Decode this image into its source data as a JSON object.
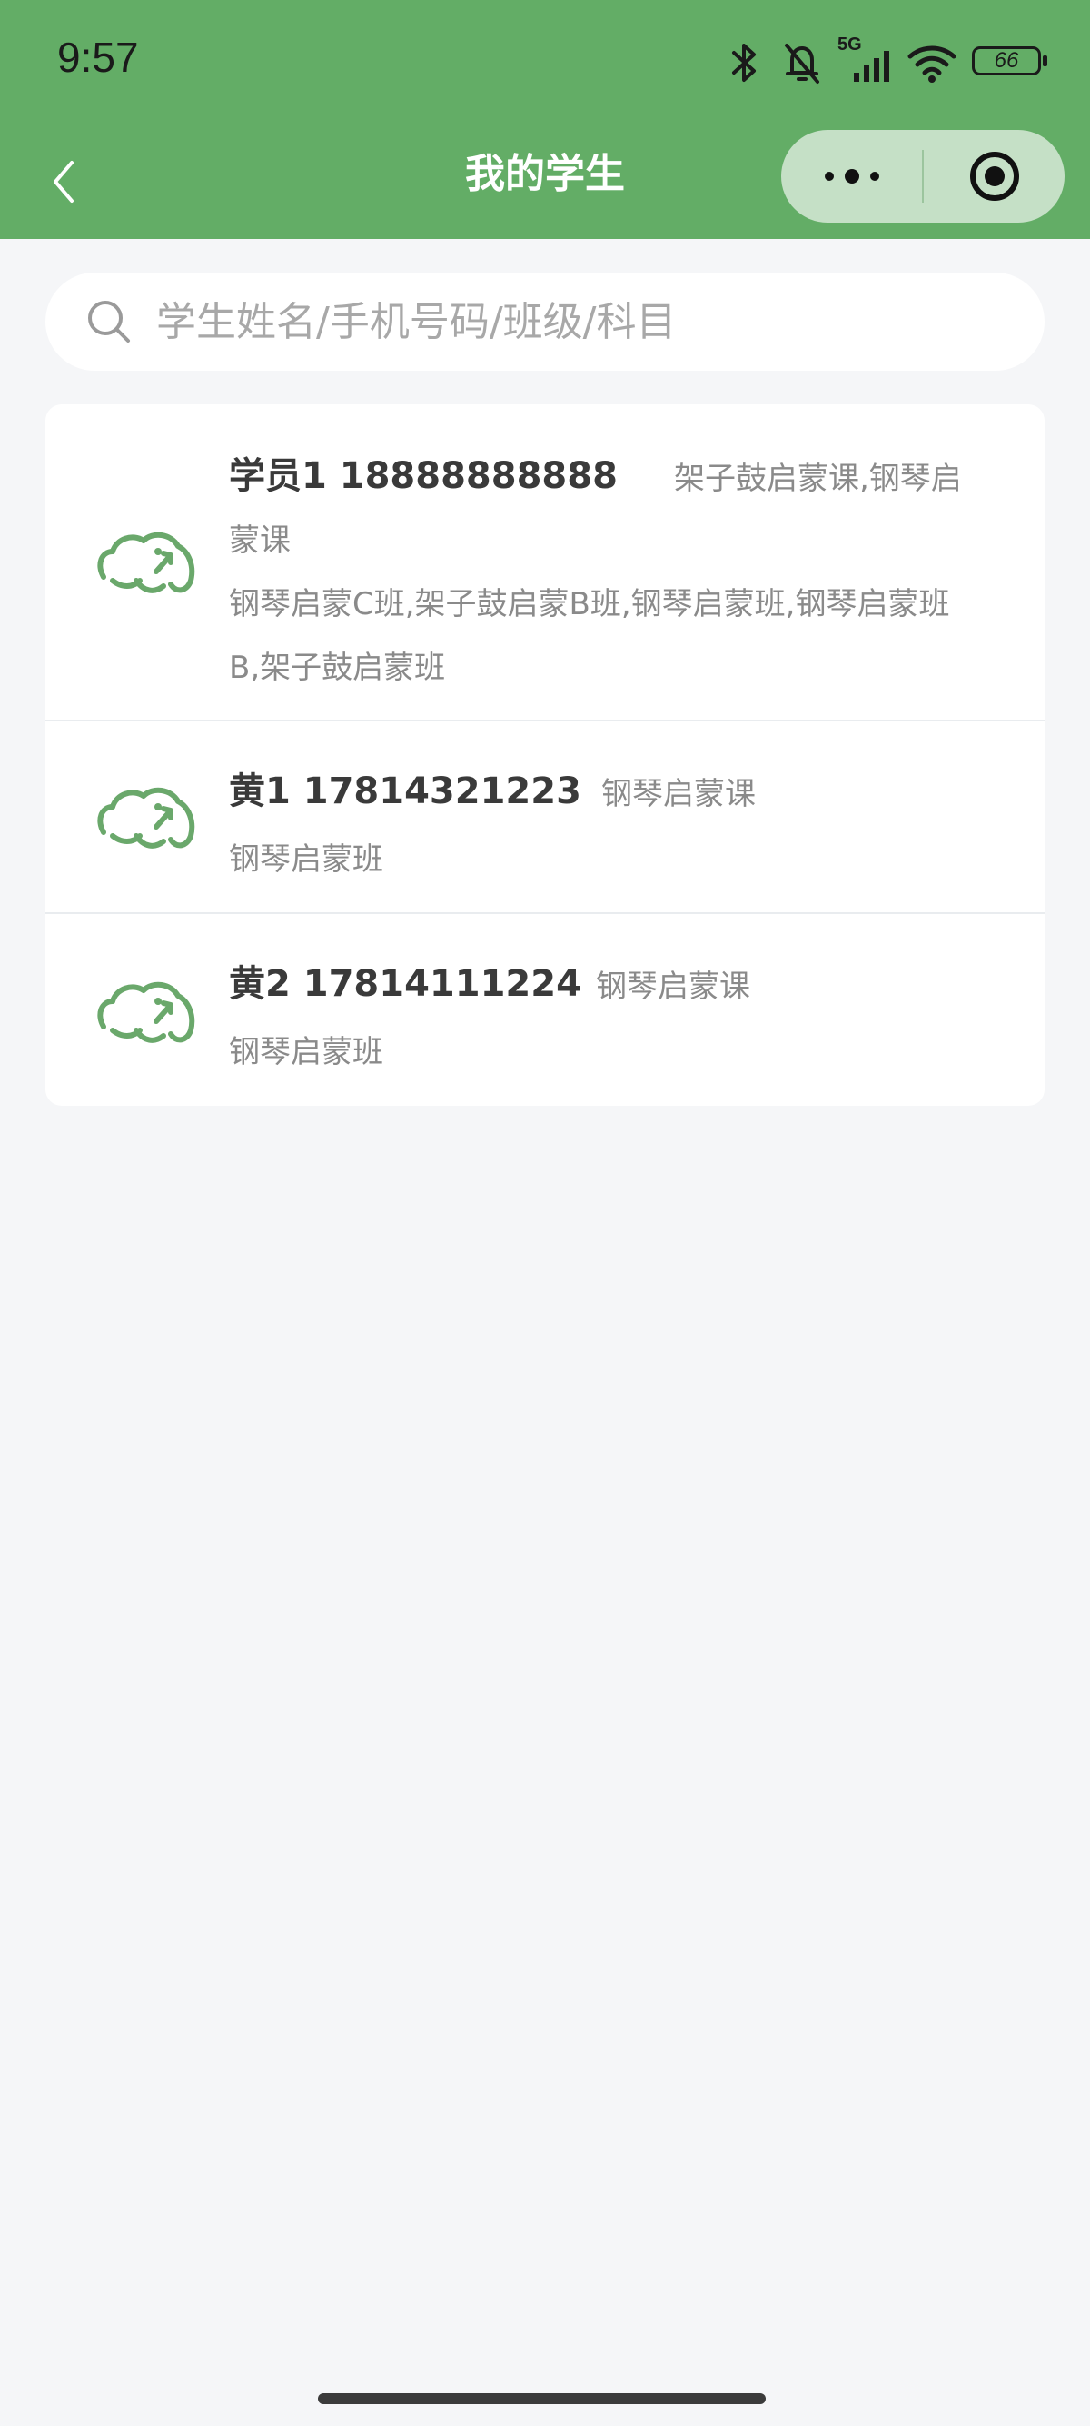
{
  "status_bar": {
    "time": "9:57",
    "network": "5G",
    "battery": "66",
    "icons": [
      "bluetooth-icon",
      "mute-bell-icon",
      "signal-5g-icon",
      "wifi-icon",
      "battery-icon"
    ]
  },
  "navbar": {
    "title": "我的学生",
    "back_icon": "chevron-left-icon",
    "more_icon": "more-dots-icon",
    "close_icon": "target-circle-icon"
  },
  "search": {
    "placeholder": "学生姓名/手机号码/班级/科目",
    "value": ""
  },
  "students": [
    {
      "name_phone": "学员1 18888888888",
      "course_part1": "架子鼓启蒙课,钢琴启",
      "course_part2": "蒙课",
      "class_line1": "钢琴启蒙C班,架子鼓启蒙B班,钢琴启蒙班,钢琴启蒙班",
      "class_line2": "B,架子鼓启蒙班"
    },
    {
      "name_phone": "黄1 17814321223",
      "course": "钢琴启蒙课",
      "class_line1": "钢琴启蒙班"
    },
    {
      "name_phone": "黄2 17814111224",
      "course": "钢琴启蒙课",
      "class_line1": "钢琴启蒙班"
    }
  ],
  "colors": {
    "header_green": "#63ad66",
    "capsule_bg": "#c5e0c6",
    "elephant_green": "#6aa86b",
    "page_bg": "#f5f6f8"
  }
}
